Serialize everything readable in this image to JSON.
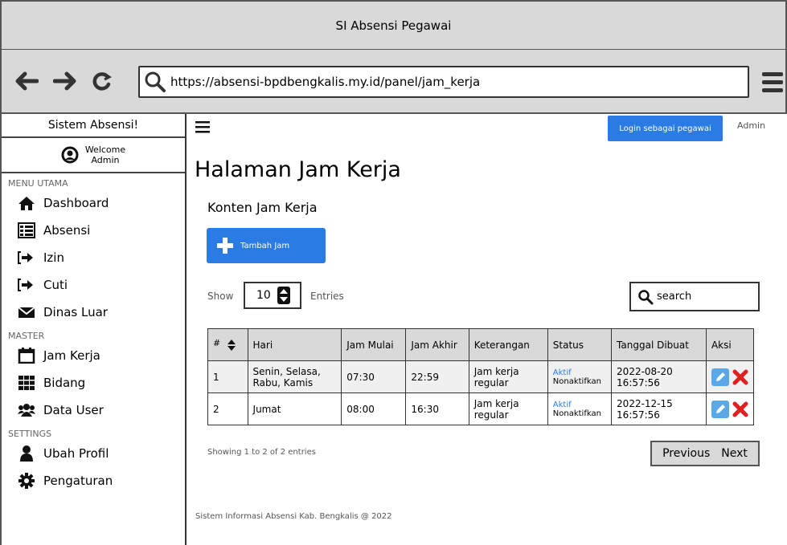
{
  "window": {
    "title": "SI Absensi Pegawai"
  },
  "browser": {
    "url": "https://absensi-bpdbengkalis.my.id/panel/jam_kerja"
  },
  "sidebar": {
    "title": "Sistem Absensi!",
    "welcome_line1": "Welcome",
    "welcome_line2": "Admin",
    "sections": {
      "menu_utama": "MENU UTAMA",
      "master": "MASTER",
      "settings": "SETTINGS"
    },
    "items": {
      "dashboard": "Dashboard",
      "absensi": "Absensi",
      "izin": "Izin",
      "cuti": "Cuti",
      "dinas_luar": "Dinas Luar",
      "jam_kerja": "Jam Kerja",
      "bidang": "Bidang",
      "data_user": "Data User",
      "ubah_profil": "Ubah Profil",
      "pengaturan": "Pengaturan"
    }
  },
  "header": {
    "login_button": "Login sebagai pegawai",
    "admin_link": "Admin"
  },
  "main": {
    "page_title": "Halaman Jam Kerja",
    "subtitle": "Konten Jam Kerja",
    "add_button": "Tambah Jam",
    "show_label": "Show",
    "entries_value": "10",
    "entries_label": "Entries",
    "search_placeholder": "search"
  },
  "table": {
    "headers": {
      "no": "#",
      "hari": "Hari",
      "jam_mulai": "Jam Mulai",
      "jam_akhir": "Jam Akhir",
      "keterangan": "Keterangan",
      "status": "Status",
      "tanggal_dibuat": "Tanggal Dibuat",
      "aksi": "Aksi"
    },
    "rows": [
      {
        "no": "1",
        "hari": "Senin, Selasa, Rabu, Kamis",
        "jam_mulai": "07:30",
        "jam_akhir": "22:59",
        "keterangan": "Jam kerja regular",
        "status_active": "Aktif",
        "status_action": "Nonaktifkan",
        "tanggal": "2022-08-20 16:57:56"
      },
      {
        "no": "2",
        "hari": "Jumat",
        "jam_mulai": "08:00",
        "jam_akhir": "16:30",
        "keterangan": "Jam kerja regular",
        "status_active": "Aktif",
        "status_action": "Nonaktifkan",
        "tanggal": "2022-12-15 16:57:56"
      }
    ]
  },
  "pagination": {
    "summary": "Showing 1 to 2 of 2 entries",
    "previous": "Previous",
    "next": "Next"
  },
  "footer": {
    "text": "Sistem Informasi Absensi Kab. Bengkalis @ 2022"
  },
  "colors": {
    "accent": "#2b7be4",
    "chrome": "#d9d9d9",
    "delete": "#e02020"
  }
}
